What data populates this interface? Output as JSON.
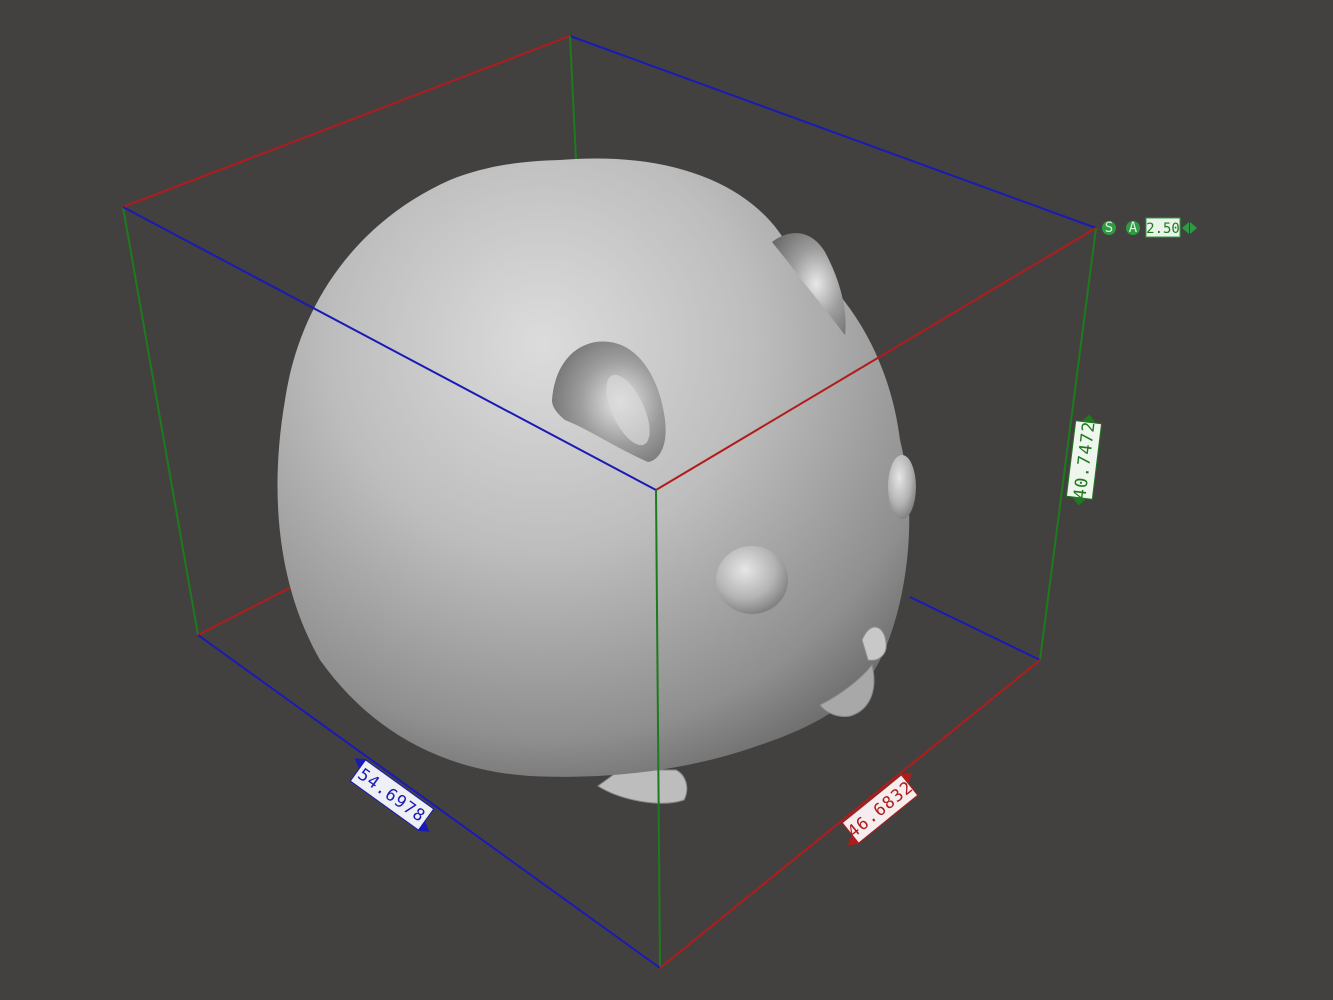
{
  "viewport": {
    "background": "#434140",
    "model": "hamster-figurine-mesh",
    "axis_colors": {
      "x": "#b01c1c",
      "y": "#1a1ab5",
      "z": "#1e7a1e"
    }
  },
  "dimensions": {
    "width_y": "54.6978",
    "depth_x": "46.6832",
    "height_z": "40.7472"
  },
  "controls": {
    "snap_label": "S",
    "angle_label": "A",
    "step_value": "2.50"
  }
}
